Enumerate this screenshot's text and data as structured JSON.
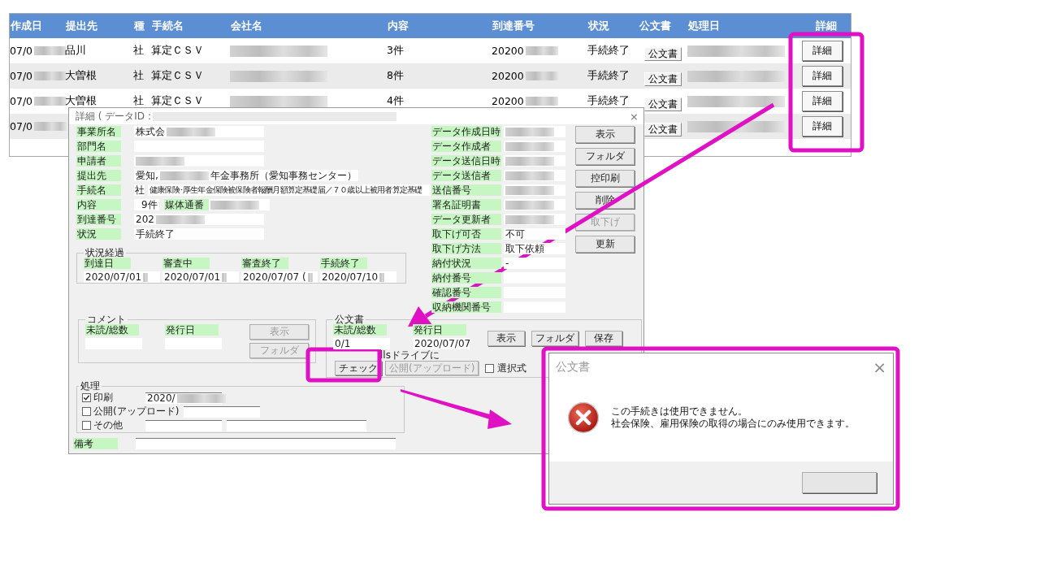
{
  "table": {
    "columns": [
      "作成日",
      "提出先",
      "種",
      "手続名",
      "会社名",
      "内容",
      "到達番号",
      "状況",
      "公文書",
      "処理日",
      "詳細"
    ],
    "rows": [
      {
        "cells": [
          {
            "kind": "text",
            "text": "07/0",
            "blurred": true
          },
          {
            "kind": "text",
            "text": "品川"
          },
          {
            "kind": "text",
            "text": "社"
          },
          {
            "kind": "text",
            "text": "算定ＣＳＶ"
          },
          {
            "kind": "blur"
          },
          {
            "kind": "text",
            "text": "3件"
          },
          {
            "kind": "text",
            "text": "20200",
            "blurred": true
          },
          {
            "kind": "text",
            "text": "手続終了"
          },
          {
            "kind": "button",
            "text": "公文書"
          },
          {
            "kind": "blur"
          },
          {
            "kind": "detail",
            "text": "詳細"
          }
        ]
      },
      {
        "cells": [
          {
            "kind": "text",
            "text": "07/0",
            "blurred": true
          },
          {
            "kind": "text",
            "text": "大曽根"
          },
          {
            "kind": "text",
            "text": "社"
          },
          {
            "kind": "text",
            "text": "算定ＣＳＶ"
          },
          {
            "kind": "blur"
          },
          {
            "kind": "text",
            "text": "8件"
          },
          {
            "kind": "text",
            "text": "20200",
            "blurred": true
          },
          {
            "kind": "text",
            "text": "手続終了"
          },
          {
            "kind": "button",
            "text": "公文書"
          },
          {
            "kind": "blur"
          },
          {
            "kind": "detail",
            "text": "詳細"
          }
        ]
      },
      {
        "cells": [
          {
            "kind": "text",
            "text": "07/0",
            "blurred": true
          },
          {
            "kind": "text",
            "text": "大曽根"
          },
          {
            "kind": "text",
            "text": "社"
          },
          {
            "kind": "text",
            "text": "算定ＣＳＶ"
          },
          {
            "kind": "blur"
          },
          {
            "kind": "text",
            "text": "4件"
          },
          {
            "kind": "text",
            "text": "20200",
            "blurred": true
          },
          {
            "kind": "text",
            "text": "手続終了"
          },
          {
            "kind": "button",
            "text": "公文書"
          },
          {
            "kind": "blur"
          },
          {
            "kind": "detail",
            "text": "詳細"
          }
        ]
      },
      {
        "cells": [
          {
            "kind": "text",
            "text": "07/0",
            "blurred": true
          },
          {
            "kind": "covered"
          },
          {
            "kind": "covered"
          },
          {
            "kind": "covered"
          },
          {
            "kind": "covered"
          },
          {
            "kind": "covered"
          },
          {
            "kind": "covered"
          },
          {
            "kind": "covered"
          },
          {
            "kind": "button",
            "text": "公文書"
          },
          {
            "kind": "blur"
          },
          {
            "kind": "detail",
            "text": "詳細"
          }
        ]
      }
    ]
  },
  "dialog": {
    "title": "詳細 ( データID :",
    "title_blurred": true,
    "close": "×",
    "left_fields": [
      {
        "label": "事業所名",
        "text": "株式会",
        "blurred": true
      },
      {
        "label": "部門名"
      },
      {
        "label": "申請者",
        "blurred": true
      },
      {
        "label": "提出先",
        "text": "愛知,",
        "blurred": true,
        "text_after": "年金事務所（愛知事務センター）"
      },
      {
        "label": "手続名",
        "prefix": "社",
        "text": "健康保険･厚生年金保険被保険者報酬月額算定基礎届／７０歳以上被用者算定基礎"
      },
      {
        "label": "内容",
        "text": "9件",
        "extra_label": "媒体通番"
      },
      {
        "label": "到達番号",
        "text": "202",
        "blurred": true
      },
      {
        "label": "状況",
        "text": "手続終了"
      }
    ],
    "right_fields": [
      {
        "label": "データ作成日時",
        "blurred": true
      },
      {
        "label": "データ作成者",
        "blurred": true
      },
      {
        "label": "データ送信日時",
        "blurred": true
      },
      {
        "label": "データ送信者",
        "blurred": true
      },
      {
        "label": "送信番号",
        "blurred": true
      },
      {
        "label": "署名証明書",
        "blurred": true
      },
      {
        "label": "データ更新者",
        "blurred": true
      },
      {
        "label": "取下げ可否",
        "text": "不可"
      },
      {
        "label": "取下げ方法",
        "text": "取下依頼"
      },
      {
        "label": "納付状況",
        "text": "-"
      },
      {
        "label": "納付番号"
      },
      {
        "label": "確認番号"
      },
      {
        "label": "収納機関番号"
      }
    ],
    "buttons": [
      {
        "label": "表示",
        "disabled": false
      },
      {
        "label": "フォルダ",
        "disabled": false
      },
      {
        "label": "控印刷",
        "disabled": false
      },
      {
        "label": "削除",
        "disabled": false
      },
      {
        "label": "取下げ",
        "disabled": true
      },
      {
        "label": "更新",
        "disabled": false
      }
    ],
    "status_history": {
      "title": "状況経過",
      "steps": [
        {
          "label": "到達日",
          "text": "2020/07/01",
          "blurred": true
        },
        {
          "label": "審査中",
          "text": "2020/07/01",
          "blurred": true
        },
        {
          "label": "審査終了",
          "text": "2020/07/07 (",
          "blurred": true
        },
        {
          "label": "手続終了",
          "text": "2020/07/10",
          "blurred": true
        }
      ]
    },
    "comment": {
      "title": "コメント",
      "fields": [
        {
          "label": "未読/総数"
        },
        {
          "label": "発行日"
        }
      ],
      "buttons": [
        {
          "label": "表示",
          "disabled": true
        },
        {
          "label": "フォルダ",
          "disabled": true
        }
      ]
    },
    "document": {
      "title": "公文書",
      "fields": [
        {
          "label": "未読/総数",
          "text": "0/1"
        },
        {
          "label": "発行日",
          "text": "2020/07/07"
        }
      ],
      "buttons": [
        {
          "label": "表示",
          "disabled": false
        },
        {
          "label": "フォルダ",
          "disabled": false
        },
        {
          "label": "保存",
          "disabled": false
        }
      ],
      "note": "llsドライブに",
      "actions": [
        {
          "label": "チェック",
          "disabled": false
        },
        {
          "label": "公開(アップロード)",
          "disabled": true
        }
      ],
      "checkbox": {
        "label": "選択式",
        "checked": false
      }
    },
    "processing": {
      "title": "処理",
      "rows": [
        {
          "label": "印刷",
          "checked": true,
          "fields": [
            {
              "kind": "short",
              "text": "2020/",
              "blurred": true
            }
          ]
        },
        {
          "label": "公開(アップロード)",
          "checked": false,
          "fields": [
            {
              "kind": "short"
            }
          ]
        },
        {
          "label": "その他",
          "checked": false,
          "fields": [
            {
              "kind": "short"
            },
            {
              "kind": "long"
            }
          ]
        }
      ]
    },
    "remarks": {
      "label": "備考"
    }
  },
  "message_box": {
    "title": "公文書",
    "close": "×",
    "lines": [
      "この手続きは使用できません。",
      "社会保険、雇用保険の取得の場合にのみ使用できます。"
    ]
  }
}
